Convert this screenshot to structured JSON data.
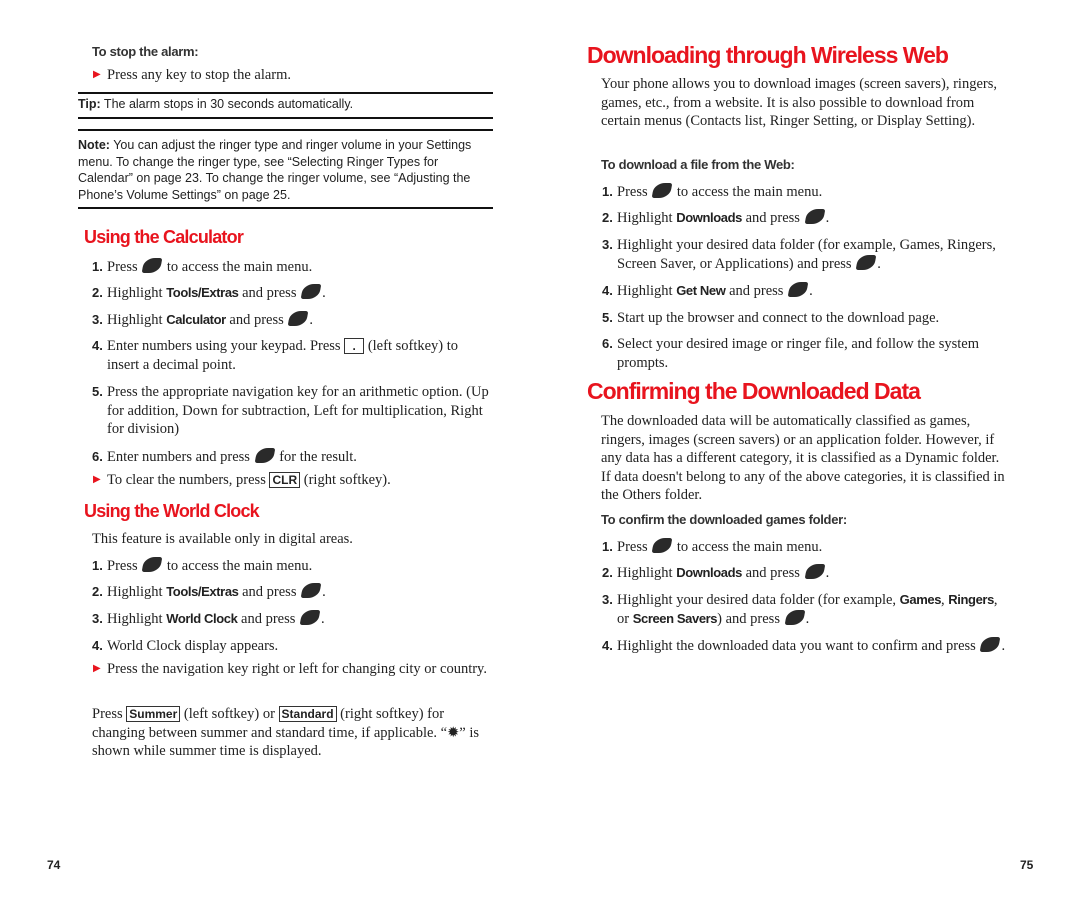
{
  "left": {
    "stop_heading": "To stop the alarm:",
    "stop_bullet": "Press any key to stop the alarm.",
    "tip_label": "Tip:",
    "tip_text": " The alarm stops in 30 seconds automatically.",
    "note_label": "Note:",
    "note_text": " You can adjust the ringer type and ringer volume in your Settings menu. To change the ringer type, see “Selecting Ringer Types for Calendar” on page 23. To change the ringer volume, see “Adjusting the Phone’s Volume Settings” on page 25.",
    "calc_heading": "Using the Calculator",
    "calc_steps": [
      {
        "n": "1.",
        "parts": [
          {
            "t": "Press "
          },
          {
            "k": "menu-ok-key"
          },
          {
            "t": " to access the main menu."
          }
        ]
      },
      {
        "n": "2.",
        "parts": [
          {
            "t": "Highlight "
          },
          {
            "b": "Tools/Extras"
          },
          {
            "t": " and press "
          },
          {
            "k": "menu-ok-key"
          },
          {
            "t": "."
          }
        ]
      },
      {
        "n": "3.",
        "parts": [
          {
            "t": "Highlight "
          },
          {
            "b": "Calculator"
          },
          {
            "t": " and press "
          },
          {
            "k": "menu-ok-key"
          },
          {
            "t": "."
          }
        ]
      },
      {
        "n": "4.",
        "parts": [
          {
            "t": "Enter numbers using your keypad. Press "
          },
          {
            "x": "."
          },
          {
            "t": " (left softkey) to insert a decimal point."
          }
        ]
      },
      {
        "n": "5.",
        "parts": [
          {
            "t": "Press the appropriate navigation key for an arithmetic option. (Up for addition, Down for subtraction, Left for multiplication, Right for division)"
          }
        ]
      },
      {
        "n": "6.",
        "parts": [
          {
            "t": "Enter numbers and press "
          },
          {
            "k": "menu-ok-key"
          },
          {
            "t": " for the result."
          }
        ]
      },
      {
        "bullet": true,
        "parts": [
          {
            "t": "To clear the numbers, press "
          },
          {
            "x": "CLR"
          },
          {
            "t": " (right softkey)."
          }
        ]
      }
    ],
    "clock_heading": "Using the World Clock",
    "clock_intro": "This feature is available only in digital areas.",
    "clock_steps": [
      {
        "n": "1.",
        "parts": [
          {
            "t": "Press "
          },
          {
            "k": "menu-ok-key"
          },
          {
            "t": " to access the main menu."
          }
        ]
      },
      {
        "n": "2.",
        "parts": [
          {
            "t": "Highlight "
          },
          {
            "b": "Tools/Extras"
          },
          {
            "t": " and press "
          },
          {
            "k": "menu-ok-key"
          },
          {
            "t": "."
          }
        ]
      },
      {
        "n": "3.",
        "parts": [
          {
            "t": "Highlight "
          },
          {
            "b": "World Clock"
          },
          {
            "t": " and press "
          },
          {
            "k": "menu-ok-key"
          },
          {
            "t": "."
          }
        ]
      },
      {
        "n": "4.",
        "parts": [
          {
            "t": "World Clock display appears."
          }
        ]
      },
      {
        "bullet": true,
        "parts": [
          {
            "t": "Press the navigation key right or left for changing city or country."
          }
        ]
      },
      {
        "para": true,
        "parts": [
          {
            "t": "Press "
          },
          {
            "x": "Summer"
          },
          {
            "t": " (left softkey) or "
          },
          {
            "x": "Standard"
          },
          {
            "t": " (right softkey) for changing between summer and standard time, if applicable. “"
          },
          {
            "s": "✹"
          },
          {
            "t": "” is shown while summer time is displayed."
          }
        ]
      }
    ],
    "page_number": "74"
  },
  "right": {
    "dl_heading": "Downloading through Wireless Web",
    "dl_intro": "Your phone allows you to download images (screen savers), ringers, games, etc., from a website. It is also possible to download from certain menus (Contacts list, Ringer Setting, or Display Setting).",
    "dl_sub": "To download a file from the Web:",
    "dl_steps": [
      {
        "n": "1.",
        "parts": [
          {
            "t": "Press "
          },
          {
            "k": "menu-ok-key"
          },
          {
            "t": " to access the main menu."
          }
        ]
      },
      {
        "n": "2.",
        "parts": [
          {
            "t": "Highlight "
          },
          {
            "b": "Downloads"
          },
          {
            "t": " and press "
          },
          {
            "k": "menu-ok-key"
          },
          {
            "t": "."
          }
        ]
      },
      {
        "n": "3.",
        "parts": [
          {
            "t": "Highlight your desired data folder (for example, Games, Ringers, Screen Saver, or Applications) and press "
          },
          {
            "k": "menu-ok-key"
          },
          {
            "t": "."
          }
        ]
      },
      {
        "n": "4.",
        "parts": [
          {
            "t": "Highlight "
          },
          {
            "b": "Get New"
          },
          {
            "t": " and press "
          },
          {
            "k": "menu-ok-key"
          },
          {
            "t": "."
          }
        ]
      },
      {
        "n": "5.",
        "parts": [
          {
            "t": "Start up the browser and connect to the download page."
          }
        ]
      },
      {
        "n": "6.",
        "parts": [
          {
            "t": "Select your desired image or ringer file, and follow the system prompts."
          }
        ]
      }
    ],
    "conf_heading": "Confirming the Downloaded Data",
    "conf_intro": "The downloaded data will be automatically classified as games, ringers, images (screen savers) or an application folder. However, if any data has a different category, it is classified as a Dynamic folder. If data doesn't belong to any of the above categories, it is classified in the Others folder.",
    "conf_sub": "To confirm the downloaded games folder:",
    "conf_steps": [
      {
        "n": "1.",
        "parts": [
          {
            "t": "Press "
          },
          {
            "k": "menu-ok-key"
          },
          {
            "t": " to access the main menu."
          }
        ]
      },
      {
        "n": "2.",
        "parts": [
          {
            "t": "Highlight "
          },
          {
            "b": "Downloads"
          },
          {
            "t": " and press "
          },
          {
            "k": "menu-ok-key"
          },
          {
            "t": "."
          }
        ]
      },
      {
        "n": "3.",
        "parts": [
          {
            "t": "Highlight your desired data folder (for example, "
          },
          {
            "b": "Games"
          },
          {
            "t": ", "
          },
          {
            "b": "Ringers"
          },
          {
            "t": ", or "
          },
          {
            "b": "Screen Savers"
          },
          {
            "t": ") and press "
          },
          {
            "k": "menu-ok-key"
          },
          {
            "t": "."
          }
        ]
      },
      {
        "n": "4.",
        "parts": [
          {
            "t": "Highlight the downloaded data you want to confirm and press "
          },
          {
            "k": "menu-ok-key"
          },
          {
            "t": "."
          }
        ]
      }
    ],
    "page_number": "75"
  },
  "colors": {
    "heading": "#e8141e",
    "bullet": "#e8141e",
    "text": "#222222"
  }
}
